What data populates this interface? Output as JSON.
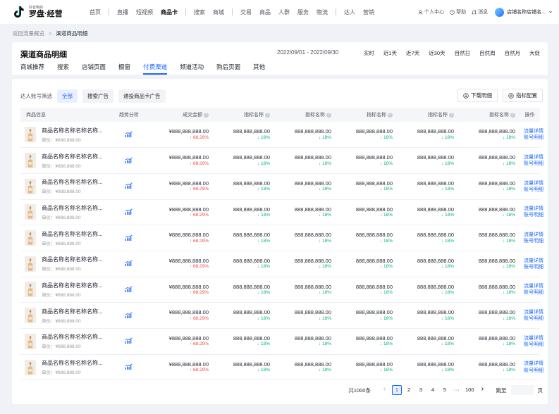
{
  "logo": {
    "small": "抖音电商",
    "big": "罗盘·经营"
  },
  "nav": {
    "group1": [
      "首页"
    ],
    "group2": [
      "直播",
      "短视频",
      "商品卡"
    ],
    "group3": [
      "搜索",
      "商城"
    ],
    "group4": [
      "交易",
      "商品",
      "人群",
      "服务",
      "物流"
    ],
    "group5": [
      "达人",
      "营销"
    ],
    "active": "商品卡"
  },
  "topright": {
    "personal": "个人中心",
    "help": "帮助",
    "msg": "消息",
    "store": "店铺名称店铺名..."
  },
  "breadcrumb": {
    "back": "返回流量概览",
    "sep": ">",
    "current": "渠道商品明细"
  },
  "header": {
    "title": "渠道商品明细",
    "date_range": "2022/09/01 - 2022/09/30",
    "periods": [
      "实时",
      "近1天",
      "近7天",
      "近30天",
      "自然日",
      "自然周",
      "自然月",
      "大促"
    ],
    "tabs": [
      "商城推荐",
      "搜索",
      "店铺页面",
      "橱窗",
      "付费渠道",
      "频道活动",
      "购后页面",
      "其他"
    ],
    "active_tab": "付费渠道"
  },
  "filter": {
    "label": "达人账号筛选",
    "chips": [
      "全部",
      "搜索广告",
      "通投商品卡广告"
    ],
    "selected": "全部"
  },
  "actions": {
    "download": "下载明细",
    "config": "指标配置"
  },
  "table": {
    "headers": {
      "product": "商品信息",
      "trend": "趋势分析",
      "gmv": "成交金额",
      "metric": "指标名称",
      "ops": "操作"
    },
    "rows": [
      {
        "name": "商品名称名称名称名称...",
        "price": "单价：¥888,888.00",
        "gmv": "¥888,888,888.00",
        "gmv_change": "↑ 68.29%",
        "metric_value": "888,888,888.00",
        "metric_change": "↓ 18%",
        "op1": "流量详情",
        "op2": "账号明细"
      },
      {
        "name": "商品名称名称名称名称...",
        "price": "单价：¥888,888.00",
        "gmv": "¥888,888,888.00",
        "gmv_change": "↑ 68.29%",
        "metric_value": "888,888,888.00",
        "metric_change": "↓ 18%",
        "op1": "流量详情",
        "op2": "账号明细"
      },
      {
        "name": "商品名称名称名称名称...",
        "price": "单价：¥888,888.00",
        "gmv": "¥888,888,888.00",
        "gmv_change": "↑ 68.29%",
        "metric_value": "888,888,888.00",
        "metric_change": "↓ 18%",
        "op1": "流量详情",
        "op2": "账号明细"
      },
      {
        "name": "商品名称名称名称名称...",
        "price": "单价：¥888,888.00",
        "gmv": "¥888,888,888.00",
        "gmv_change": "↑ 68.29%",
        "metric_value": "888,888,888.00",
        "metric_change": "↓ 18%",
        "op1": "流量详情",
        "op2": "账号明细"
      },
      {
        "name": "商品名称名称名称名称...",
        "price": "单价：¥888,888.00",
        "gmv": "¥888,888,888.00",
        "gmv_change": "↑ 68.29%",
        "metric_value": "888,888,888.00",
        "metric_change": "↓ 18%",
        "op1": "流量详情",
        "op2": "账号明细"
      },
      {
        "name": "商品名称名称名称名称...",
        "price": "单价：¥888,888.00",
        "gmv": "¥888,888,888.00",
        "gmv_change": "↑ 68.29%",
        "metric_value": "888,888,888.00",
        "metric_change": "↓ 18%",
        "op1": "流量详情",
        "op2": "账号明细"
      },
      {
        "name": "商品名称名称名称名称...",
        "price": "单价：¥888,888.00",
        "gmv": "¥888,888,888.00",
        "gmv_change": "↑ 68.29%",
        "metric_value": "888,888,888.00",
        "metric_change": "↓ 18%",
        "op1": "流量详情",
        "op2": "账号明细"
      },
      {
        "name": "商品名称名称名称名称...",
        "price": "单价：¥888,888.00",
        "gmv": "¥888,888,888.00",
        "gmv_change": "↑ 68.29%",
        "metric_value": "888,888,888.00",
        "metric_change": "↓ 18%",
        "op1": "流量详情",
        "op2": "账号明细"
      },
      {
        "name": "商品名称名称名称名称...",
        "price": "单价：¥888,888.00",
        "gmv": "¥888,888,888.00",
        "gmv_change": "↑ 68.29%",
        "metric_value": "888,888,888.00",
        "metric_change": "↓ 18%",
        "op1": "流量详情",
        "op2": "账号明细"
      },
      {
        "name": "商品名称名称名称名称...",
        "price": "单价：¥888,888.00",
        "gmv": "¥888,888,888.00",
        "gmv_change": "↑ 68.29%",
        "metric_value": "888,888,888.00",
        "metric_change": "↓ 18%",
        "op1": "流量详情",
        "op2": "账号明细"
      }
    ]
  },
  "pager": {
    "total": "共1000条",
    "pages": [
      "1",
      "2",
      "3",
      "4",
      "5",
      "···",
      "100"
    ],
    "current": "1",
    "jump_label": "跳至",
    "jump_unit": "页"
  },
  "colors": {
    "accent": "#1966ff",
    "up": "#f54a45",
    "down": "#00b578"
  },
  "icons": [
    "tiktok-logo-icon",
    "user-icon",
    "help-icon",
    "bell-icon",
    "chevron-down-icon",
    "download-icon",
    "settings-icon",
    "trend-chart-icon",
    "chevron-left-icon",
    "chevron-right-icon"
  ]
}
